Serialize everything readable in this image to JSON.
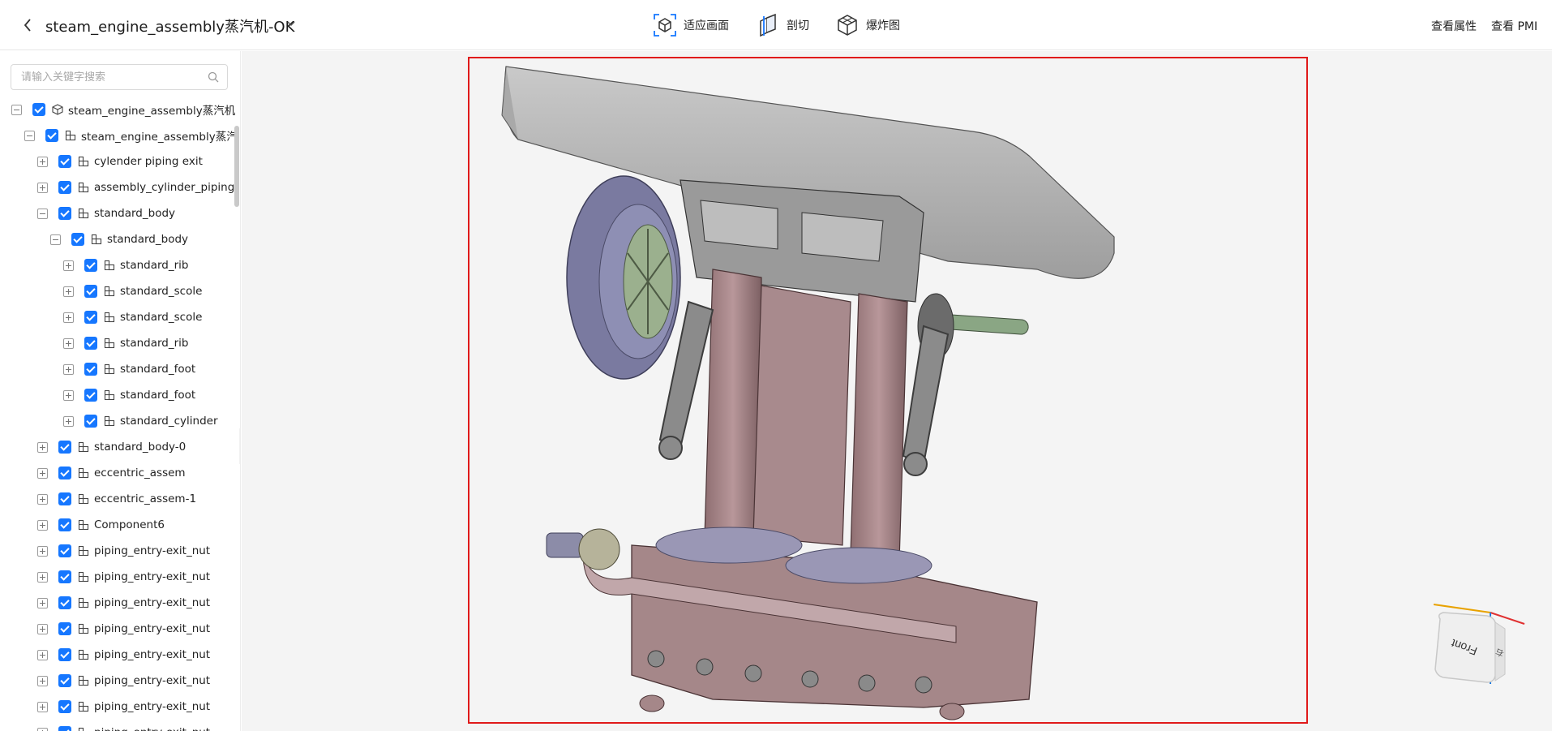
{
  "header": {
    "title": "steam_engine_assembly蒸汽机-OK",
    "tools": [
      {
        "label": "适应画面",
        "icon": "fit-view-icon"
      },
      {
        "label": "剖切",
        "icon": "section-cut-icon"
      },
      {
        "label": "爆炸图",
        "icon": "explode-view-icon"
      }
    ],
    "right_links": [
      "查看属性",
      "查看 PMI"
    ]
  },
  "sidebar": {
    "search_placeholder": "请输入关键字搜索",
    "tree": [
      {
        "label": "steam_engine_assembly蒸汽机-OK",
        "depth": 0,
        "expanded": true,
        "icon": "assembly-root-icon"
      },
      {
        "label": "steam_engine_assembly蒸汽机",
        "depth": 1,
        "expanded": true,
        "icon": "component-icon"
      },
      {
        "label": "cylender piping exit",
        "depth": 2,
        "expanded": false,
        "icon": "component-icon"
      },
      {
        "label": "assembly_cylinder_piping_e",
        "depth": 2,
        "expanded": false,
        "icon": "component-icon"
      },
      {
        "label": "standard_body",
        "depth": 2,
        "expanded": true,
        "icon": "component-icon"
      },
      {
        "label": "standard_body",
        "depth": 3,
        "expanded": true,
        "icon": "component-icon"
      },
      {
        "label": "standard_rib",
        "depth": 4,
        "expanded": false,
        "icon": "component-icon"
      },
      {
        "label": "standard_scole",
        "depth": 4,
        "expanded": false,
        "icon": "component-icon"
      },
      {
        "label": "standard_scole",
        "depth": 4,
        "expanded": false,
        "icon": "component-icon"
      },
      {
        "label": "standard_rib",
        "depth": 4,
        "expanded": false,
        "icon": "component-icon"
      },
      {
        "label": "standard_foot",
        "depth": 4,
        "expanded": false,
        "icon": "component-icon"
      },
      {
        "label": "standard_foot",
        "depth": 4,
        "expanded": false,
        "icon": "component-icon"
      },
      {
        "label": "standard_cylinder",
        "depth": 4,
        "expanded": false,
        "icon": "component-icon"
      },
      {
        "label": "standard_body-0",
        "depth": 2,
        "expanded": false,
        "icon": "component-icon"
      },
      {
        "label": "eccentric_assem",
        "depth": 2,
        "expanded": false,
        "icon": "component-icon"
      },
      {
        "label": "eccentric_assem-1",
        "depth": 2,
        "expanded": false,
        "icon": "component-icon"
      },
      {
        "label": "Component6",
        "depth": 2,
        "expanded": false,
        "icon": "component-icon"
      },
      {
        "label": "piping_entry-exit_nut",
        "depth": 2,
        "expanded": false,
        "icon": "component-icon"
      },
      {
        "label": "piping_entry-exit_nut",
        "depth": 2,
        "expanded": false,
        "icon": "component-icon"
      },
      {
        "label": "piping_entry-exit_nut",
        "depth": 2,
        "expanded": false,
        "icon": "component-icon"
      },
      {
        "label": "piping_entry-exit_nut",
        "depth": 2,
        "expanded": false,
        "icon": "component-icon"
      },
      {
        "label": "piping_entry-exit_nut",
        "depth": 2,
        "expanded": false,
        "icon": "component-icon"
      },
      {
        "label": "piping_entry-exit_nut",
        "depth": 2,
        "expanded": false,
        "icon": "component-icon"
      },
      {
        "label": "piping_entry-exit_nut",
        "depth": 2,
        "expanded": false,
        "icon": "component-icon"
      },
      {
        "label": "piping_entry-exit_nut",
        "depth": 2,
        "expanded": false,
        "icon": "component-icon"
      }
    ]
  },
  "viewer": {
    "selection_color": "#e01a1a",
    "viewcube_face_label": "Front",
    "viewcube_side_label": "右"
  },
  "colors": {
    "accent": "#1677ff",
    "viewport_bg": "#f4f4f4"
  }
}
